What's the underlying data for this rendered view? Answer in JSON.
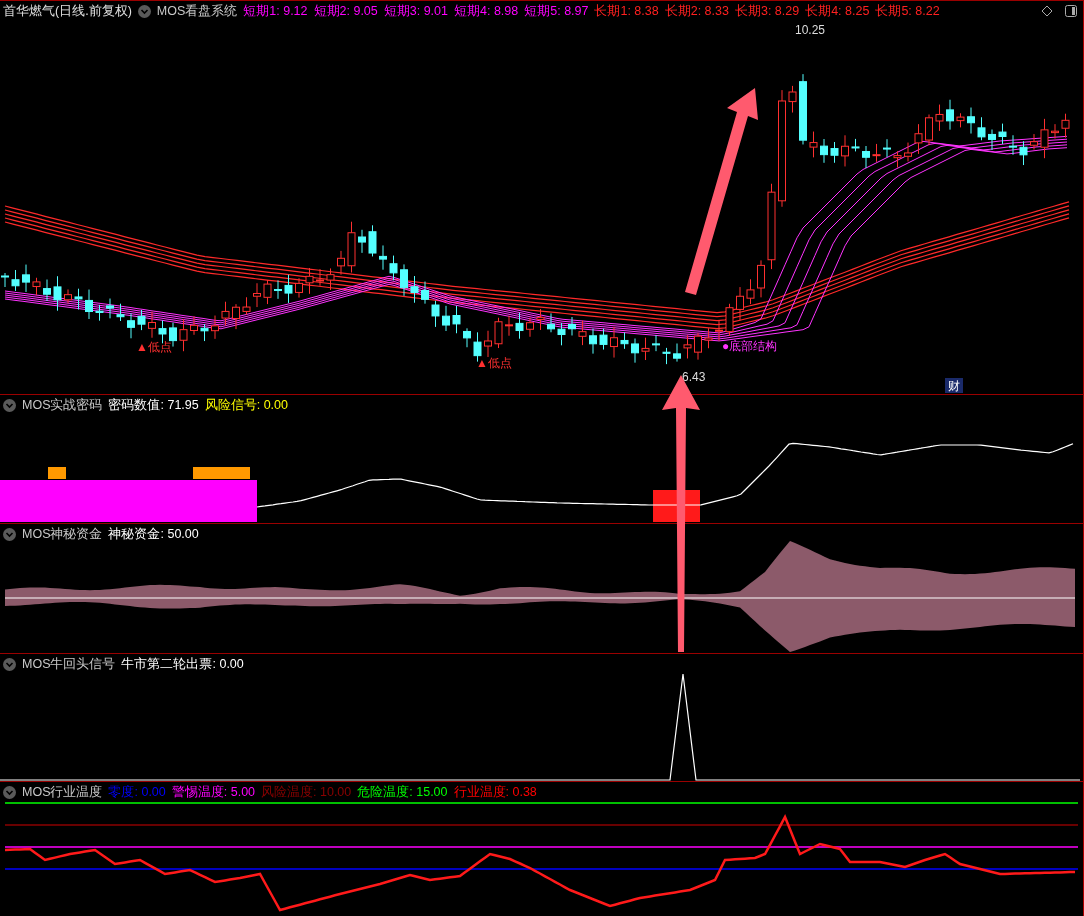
{
  "main": {
    "kind": "main",
    "title": "首华燃气(日线.前复权)",
    "indicator": "MOS看盘系统",
    "values": [
      {
        "label": "短期1:",
        "value": "9.12",
        "color": "#ff00ff"
      },
      {
        "label": "短期2:",
        "value": "9.05",
        "color": "#ff00ff"
      },
      {
        "label": "短期3:",
        "value": "9.01",
        "color": "#ff00ff"
      },
      {
        "label": "短期4:",
        "value": "8.98",
        "color": "#ff00ff"
      },
      {
        "label": "短期5:",
        "value": "8.97",
        "color": "#ff00ff"
      },
      {
        "label": "长期1:",
        "value": "8.38",
        "color": "#ff2020"
      },
      {
        "label": "长期2:",
        "value": "8.33",
        "color": "#ff2020"
      },
      {
        "label": "长期3:",
        "value": "8.29",
        "color": "#ff2020"
      },
      {
        "label": "长期4:",
        "value": "8.25",
        "color": "#ff2020"
      },
      {
        "label": "长期5:",
        "value": "8.22",
        "color": "#ff2020"
      }
    ],
    "high_label": "10.25",
    "low_label": "6.43",
    "annotations": [
      {
        "kind": "low",
        "text": "▲低点"
      },
      {
        "kind": "low",
        "text": "▲低点"
      },
      {
        "kind": "bottom",
        "text": "●底部结构"
      },
      {
        "kind": "tag",
        "text": "财"
      }
    ]
  },
  "panels": [
    {
      "kind": "code",
      "indicator": "MOS实战密码",
      "values": [
        {
          "label": "密码数值:",
          "value": "71.95",
          "color": "#ffffff"
        },
        {
          "label": "风险信号:",
          "value": "0.00",
          "color": "#ffff00"
        }
      ]
    },
    {
      "kind": "fund",
      "indicator": "MOS神秘资金",
      "values": [
        {
          "label": "神秘资金:",
          "value": "50.00",
          "color": "#ffffff"
        }
      ]
    },
    {
      "kind": "signal",
      "indicator": "MOS牛回头信号",
      "values": [
        {
          "label": "牛市第二轮出票:",
          "value": "0.00",
          "color": "#ffffff"
        }
      ]
    },
    {
      "kind": "temperature",
      "indicator": "MOS行业温度",
      "values": [
        {
          "label": "零度:",
          "value": "0.00",
          "color": "#0000ff"
        },
        {
          "label": "警惕温度:",
          "value": "5.00",
          "color": "#ff00ff"
        },
        {
          "label": "风险温度:",
          "value": "10.00",
          "color": "#8b0000"
        },
        {
          "label": "危险温度:",
          "value": "15.00",
          "color": "#00ff00"
        },
        {
          "label": "行业温度:",
          "value": "0.38",
          "color": "#ff0000"
        }
      ]
    }
  ]
}
